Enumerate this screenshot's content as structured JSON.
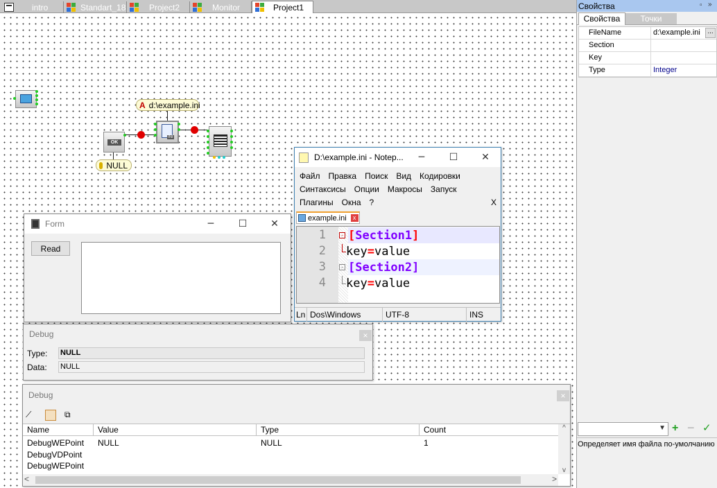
{
  "tabs": [
    {
      "label": "intro",
      "icon": "page-icon"
    },
    {
      "label": "Standart_18",
      "icon": "windows-flag-icon"
    },
    {
      "label": "Project2",
      "icon": "windows-flag-icon"
    },
    {
      "label": "Monitor",
      "icon": "windows-flag-icon"
    },
    {
      "label": "Project1",
      "icon": "windows-flag-icon",
      "active": true
    }
  ],
  "canvas": {
    "ini_hint": "d:\\example.ini",
    "null_hint": "NULL",
    "button_caption": "OK",
    "ini_caption": "INI"
  },
  "properties": {
    "title": "Свойства",
    "tabs": [
      "Свойства",
      "Точки"
    ],
    "rows": [
      {
        "name": "FileName",
        "value": "d:\\example.ini"
      },
      {
        "name": "Section",
        "value": ""
      },
      {
        "name": "Key",
        "value": ""
      },
      {
        "name": "Type",
        "value": "Integer"
      }
    ],
    "browse_label": "...",
    "description": "Определяет имя файла по-умолчанию",
    "value_color": "#00008b"
  },
  "form_window": {
    "title": "Form",
    "read_button": "Read"
  },
  "debug_small": {
    "title": "Debug",
    "type_label": "Type:",
    "type_value": "NULL",
    "data_label": "Data:",
    "data_value": "NULL"
  },
  "notepad": {
    "title": "D:\\example.ini - Notep...",
    "menu_row1": [
      "Файл",
      "Правка",
      "Поиск",
      "Вид",
      "Кодировки"
    ],
    "menu_row2": [
      "Синтаксисы",
      "Опции",
      "Макросы",
      "Запуск"
    ],
    "menu_row3": [
      "Плагины",
      "Окна",
      "?"
    ],
    "menu_close": "X",
    "file_tab": "example.ini",
    "lines": [
      {
        "num": "1",
        "section": "Section1"
      },
      {
        "num": "2",
        "key": "key",
        "eq": "=",
        "value": "value"
      },
      {
        "num": "3",
        "section": "Section2"
      },
      {
        "num": "4",
        "key": "key",
        "eq": "=",
        "value": "value"
      }
    ],
    "status": {
      "ln": "Ln",
      "eol": "Dos\\Windows",
      "encoding": "UTF-8",
      "mode": "INS"
    }
  },
  "debug_large": {
    "title": "Debug",
    "columns": [
      "Name",
      "Value",
      "Type",
      "Count"
    ],
    "rows": [
      {
        "name": "DebugWEPoint",
        "value": "NULL",
        "type": "NULL",
        "count": "1"
      },
      {
        "name": "DebugVDPoint",
        "value": "",
        "type": "",
        "count": ""
      },
      {
        "name": "DebugWEPoint",
        "value": "",
        "type": "",
        "count": ""
      }
    ]
  },
  "colors": {
    "canvas_bg": "#ffffff",
    "section_color": "#8000ff",
    "bracket_color": "#ff0000",
    "accent_add": "#22a022"
  }
}
